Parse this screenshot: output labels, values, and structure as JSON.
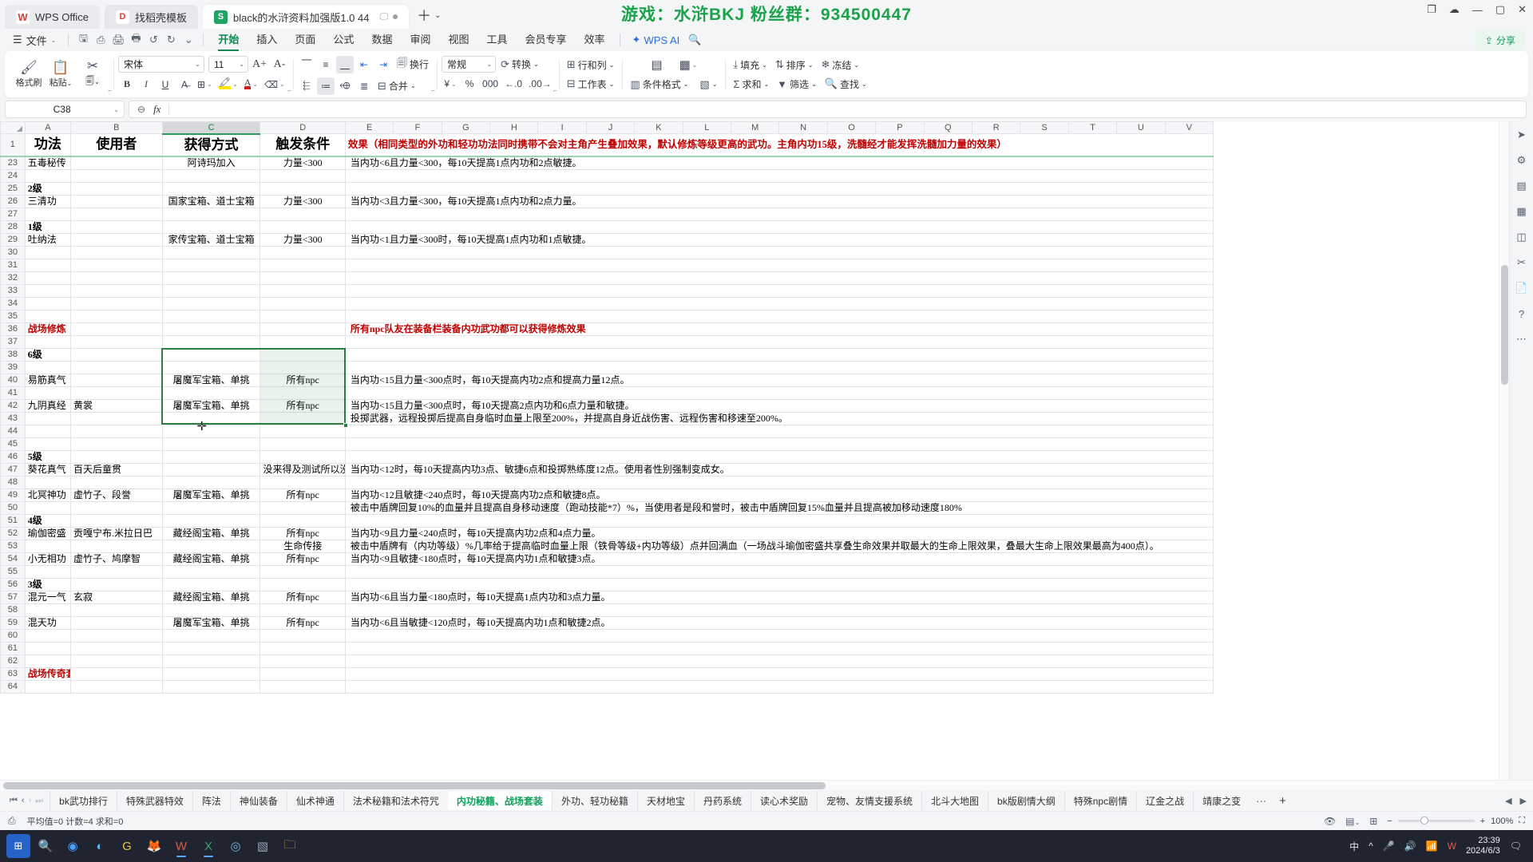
{
  "window": {
    "banner": "游戏：水浒BKJ    粉丝群：934500447",
    "app_tabs": [
      {
        "label": "WPS Office",
        "icon": "wps-logo-icon",
        "active": false
      },
      {
        "label": "找稻壳模板",
        "icon": "template-icon",
        "active": false
      },
      {
        "label": "black的水浒资料加强版1.0 44",
        "icon": "spreadsheet-icon",
        "active": true
      }
    ],
    "controls": {
      "minimize": "—",
      "maximize": "▢",
      "close": "✕",
      "restore": "⧉",
      "cloud": "☁",
      "avatar": "◍"
    }
  },
  "menubar": {
    "file_label": "文件",
    "quick_icons": [
      "save-icon",
      "save-as-icon",
      "print-icon",
      "print-preview-icon",
      "undo-icon",
      "redo-icon",
      "customize-icon"
    ],
    "tabs": [
      {
        "label": "开始",
        "active": true
      },
      {
        "label": "插入",
        "active": false
      },
      {
        "label": "页面",
        "active": false
      },
      {
        "label": "公式",
        "active": false
      },
      {
        "label": "数据",
        "active": false
      },
      {
        "label": "审阅",
        "active": false
      },
      {
        "label": "视图",
        "active": false
      },
      {
        "label": "工具",
        "active": false
      },
      {
        "label": "会员专享",
        "active": false
      },
      {
        "label": "效率",
        "active": false
      }
    ],
    "ai_label": "WPS AI",
    "search_icon": "search-icon",
    "share_label": "分享"
  },
  "ribbon": {
    "clipboard": {
      "format_painter": "格式刷",
      "paste": "粘贴",
      "copy": "复制"
    },
    "font": {
      "family": "宋体",
      "size": "11",
      "grow": "A+",
      "shrink": "A-",
      "bold": "B",
      "italic": "I",
      "underline": "U",
      "strike": "A",
      "border": "田",
      "highlight": "highlight-icon",
      "fontcolor": "fontcolor-icon",
      "clear": "clear-format-icon"
    },
    "align": {
      "top": "align-top-icon",
      "middle": "align-middle-icon",
      "bottom": "align-bottom-icon",
      "indent_dec": "indent-decrease-icon",
      "indent_inc": "indent-increase-icon",
      "wrap": "换行",
      "left": "align-left-icon",
      "center": "align-center-icon",
      "right": "align-right-icon",
      "justify": "align-justify-icon",
      "merge": "合并"
    },
    "number": {
      "format": "常规",
      "convert": "转换",
      "currency": "¥",
      "percent": "%",
      "comma": "000",
      "dec_dec": "←.0",
      "dec_inc": ".00→"
    },
    "cells": {
      "rows_cols": "行和列",
      "worksheet": "工作表"
    },
    "styles": {
      "cond_format": "条件格式",
      "table_style": "表格样式",
      "cell_style": "cell-style-icon"
    },
    "editing": {
      "fill": "填充",
      "sort": "排序",
      "freeze": "冻结",
      "autosum": "求和",
      "filter": "筛选",
      "find": "查找"
    }
  },
  "formula_bar": {
    "name_box": "C38",
    "formula": "",
    "fx_label": "fx",
    "zoom_icon": "insert-function-icon"
  },
  "grid": {
    "columns": [
      "A",
      "B",
      "C",
      "D",
      "E",
      "F",
      "G",
      "H",
      "I",
      "J",
      "K",
      "L",
      "M",
      "N",
      "O",
      "P",
      "Q",
      "R",
      "S",
      "T",
      "U",
      "V"
    ],
    "selected_column": "C",
    "header_row": {
      "num": "1",
      "A": "功法",
      "B": "使用者",
      "C": "获得方式",
      "D": "触发条件",
      "E": "效果（相同类型的外功和轻功功法同时携带不会对主角产生叠加效果，默认修炼等级更高的武功。主角内功15级，洗髓经才能发挥洗髓加力量的效果）"
    },
    "rows": [
      {
        "num": "23",
        "A": "五毒秘传",
        "B": "",
        "C": "阿诗玛加入",
        "D": "力量<300",
        "E": "当内功<6且力量<300，每10天提高1点内功和2点敏捷。"
      },
      {
        "num": "24",
        "A": "",
        "B": "",
        "C": "",
        "D": "",
        "E": ""
      },
      {
        "num": "25",
        "A": "2级",
        "B": "",
        "C": "",
        "D": "",
        "E": "",
        "bold": true
      },
      {
        "num": "26",
        "A": "三清功",
        "B": "",
        "C": "国家宝箱、道士宝箱",
        "D": "力量<300",
        "E": "当内功<3且力量<300，每10天提高1点内功和2点力量。"
      },
      {
        "num": "27",
        "A": "",
        "B": "",
        "C": "",
        "D": "",
        "E": ""
      },
      {
        "num": "28",
        "A": "1级",
        "B": "",
        "C": "",
        "D": "",
        "E": "",
        "bold": true
      },
      {
        "num": "29",
        "A": "吐纳法",
        "B": "",
        "C": "家传宝箱、道士宝箱",
        "D": "力量<300",
        "E": "当内功<1且力量<300时，每10天提高1点内功和1点敏捷。"
      },
      {
        "num": "30",
        "A": "",
        "B": "",
        "C": "",
        "D": "",
        "E": ""
      },
      {
        "num": "31",
        "A": "",
        "B": "",
        "C": "",
        "D": "",
        "E": ""
      },
      {
        "num": "32",
        "A": "",
        "B": "",
        "C": "",
        "D": "",
        "E": ""
      },
      {
        "num": "33",
        "A": "",
        "B": "",
        "C": "",
        "D": "",
        "E": ""
      },
      {
        "num": "34",
        "A": "",
        "B": "",
        "C": "",
        "D": "",
        "E": ""
      },
      {
        "num": "35",
        "A": "",
        "B": "",
        "C": "",
        "D": "",
        "E": ""
      },
      {
        "num": "36",
        "A": "战场修炼",
        "B": "",
        "C": "",
        "D": "",
        "E": "所有npc队友在装备栏装备内功武功都可以获得修炼效果",
        "red": true
      },
      {
        "num": "37",
        "A": "",
        "B": "",
        "C": "",
        "D": "",
        "E": ""
      },
      {
        "num": "38",
        "A": "6级",
        "B": "",
        "C": "",
        "D": "",
        "E": "",
        "bold": true
      },
      {
        "num": "39",
        "A": "",
        "B": "",
        "C": "",
        "D": "",
        "E": ""
      },
      {
        "num": "40",
        "A": "易筋真气",
        "B": "",
        "C": "屠魔军宝箱、单挑",
        "D": "所有npc",
        "E": "当内功<15且力量<300点时，每10天提高内功2点和提高力量12点。"
      },
      {
        "num": "41",
        "A": "",
        "B": "",
        "C": "",
        "D": "",
        "E": ""
      },
      {
        "num": "42",
        "A": "九阴真经",
        "B": "黄裳",
        "C": "屠魔军宝箱、单挑",
        "D": "所有npc",
        "E": "当内功<15且力量<300点时，每10天提高2点内功和6点力量和敏捷。"
      },
      {
        "num": "43",
        "A": "",
        "B": "",
        "C": "",
        "D": "",
        "E": "投掷武器，远程投掷后提高自身临时血量上限至200%，并提高自身近战伤害、远程伤害和移速至200%。"
      },
      {
        "num": "44",
        "A": "",
        "B": "",
        "C": "",
        "D": "",
        "E": ""
      },
      {
        "num": "45",
        "A": "",
        "B": "",
        "C": "",
        "D": "",
        "E": ""
      },
      {
        "num": "46",
        "A": "5级",
        "B": "",
        "C": "",
        "D": "",
        "E": "",
        "bold": true
      },
      {
        "num": "47",
        "A": "葵花真气",
        "B": "百天后童贯",
        "C": "",
        "D": "没来得及测试所以没实装",
        "E": "当内功<12时，每10天提高内功3点、敏捷6点和投掷熟练度12点。使用者性别强制变成女。"
      },
      {
        "num": "48",
        "A": "",
        "B": "",
        "C": "",
        "D": "",
        "E": ""
      },
      {
        "num": "49",
        "A": "北冥神功",
        "B": "虚竹子、段誉",
        "C": "屠魔军宝箱、单挑",
        "D": "所有npc",
        "E": "当内功<12且敏捷<240点时，每10天提高内功2点和敏捷8点。"
      },
      {
        "num": "50",
        "A": "",
        "B": "",
        "C": "",
        "D": "",
        "E": "被击中盾牌回复10%的血量并且提高自身移动速度（跑动技能*7）%，当使用者是段和誉时，被击中盾牌回复15%血量并且提高被加移动速度180%"
      },
      {
        "num": "51",
        "A": "4级",
        "B": "",
        "C": "",
        "D": "",
        "E": "",
        "bold": true
      },
      {
        "num": "52",
        "A": "瑜伽密盛",
        "B": "贡嘎宁布.米拉日巴",
        "C": "藏经阁宝箱、单挑",
        "D": "所有npc",
        "E": "当内功<9且力量<240点时，每10天提高内功2点和4点力量。"
      },
      {
        "num": "53",
        "A": "",
        "B": "",
        "C": "",
        "D": "生命传接",
        "E": "被击中盾牌有（内功等级）%几率给于提高临时血量上限（铁骨等级+内功等级）点并回满血（一场战斗瑜伽密盛共享叠生命效果并取最大的生命上限效果，叠最大生命上限效果最高为400点）。"
      },
      {
        "num": "54",
        "A": "小无相功",
        "B": "虚竹子、鸠摩智",
        "C": "藏经阁宝箱、单挑",
        "D": "所有npc",
        "E": "当内功<9且敏捷<180点时，每10天提高内功1点和敏捷3点。"
      },
      {
        "num": "55",
        "A": "",
        "B": "",
        "C": "",
        "D": "",
        "E": ""
      },
      {
        "num": "56",
        "A": "3级",
        "B": "",
        "C": "",
        "D": "",
        "E": "",
        "bold": true
      },
      {
        "num": "57",
        "A": "混元一气",
        "B": "玄寂",
        "C": "藏经阁宝箱、单挑",
        "D": "所有npc",
        "E": "当内功<6且当力量<180点时，每10天提高1点内功和3点力量。"
      },
      {
        "num": "58",
        "A": "",
        "B": "",
        "C": "",
        "D": "",
        "E": ""
      },
      {
        "num": "59",
        "A": "混天功",
        "B": "",
        "C": "屠魔军宝箱、单挑",
        "D": "所有npc",
        "E": "当内功<6且当敏捷<120点时，每10天提高内功1点和敏捷2点。"
      },
      {
        "num": "60",
        "A": "",
        "B": "",
        "C": "",
        "D": "",
        "E": ""
      },
      {
        "num": "61",
        "A": "",
        "B": "",
        "C": "",
        "D": "",
        "E": ""
      },
      {
        "num": "62",
        "A": "",
        "B": "",
        "C": "",
        "D": "",
        "E": ""
      },
      {
        "num": "63",
        "A": "战场传奇套装",
        "B": "",
        "C": "",
        "D": "",
        "E": "",
        "red": true
      },
      {
        "num": "64",
        "A": "",
        "B": "",
        "C": "",
        "D": "",
        "E": ""
      }
    ],
    "selection_range": "C38:D43"
  },
  "sheet_tabs": {
    "nav": {
      "first": "⏮",
      "prev": "‹",
      "next": "›",
      "last": "⏭"
    },
    "tabs": [
      {
        "label": "bk武功排行",
        "active": false
      },
      {
        "label": "特殊武器特效",
        "active": false
      },
      {
        "label": "阵法",
        "active": false
      },
      {
        "label": "神仙装备",
        "active": false
      },
      {
        "label": "仙术神通",
        "active": false
      },
      {
        "label": "法术秘籍和法术符咒",
        "active": false
      },
      {
        "label": "内功秘籍、战场套装",
        "active": true
      },
      {
        "label": "外功、轻功秘籍",
        "active": false
      },
      {
        "label": "天材地宝",
        "active": false
      },
      {
        "label": "丹药系统",
        "active": false
      },
      {
        "label": "读心术奖励",
        "active": false
      },
      {
        "label": "宠物、友情支援系统",
        "active": false
      },
      {
        "label": "北斗大地图",
        "active": false
      },
      {
        "label": "bk版剧情大纲",
        "active": false
      },
      {
        "label": "特殊npc剧情",
        "active": false
      },
      {
        "label": "辽金之战",
        "active": false
      },
      {
        "label": "靖康之变",
        "active": false
      }
    ],
    "more": "···",
    "add": "+"
  },
  "status_bar": {
    "summary": "平均值=0  计数=4  求和=0",
    "view_icons": [
      "page-view-icon",
      "layout-view-icon",
      "pagebreak-view-icon"
    ],
    "zoom_out": "−",
    "zoom_in": "+",
    "zoom_level": "100%"
  },
  "taskbar": {
    "start": "start-icon",
    "items": [
      "search-icon",
      "browser-icon",
      "chrome-icon",
      "app-icon",
      "wps-icon",
      "excel-icon",
      "game-icon",
      "media-icon",
      "editor-icon",
      "folder-icon"
    ],
    "tray": {
      "input_method": "中",
      "chevron": "^",
      "mic": "mic-icon",
      "volume": "volume-icon",
      "network": "network-icon",
      "wps_tray": "W"
    },
    "time": "23:39",
    "date": "2024/6/3"
  },
  "colors": {
    "accent_green": "#12a05c",
    "red_text": "#c00000",
    "selection_border": "#2d7d46",
    "banner_green": "#1aa34a"
  }
}
